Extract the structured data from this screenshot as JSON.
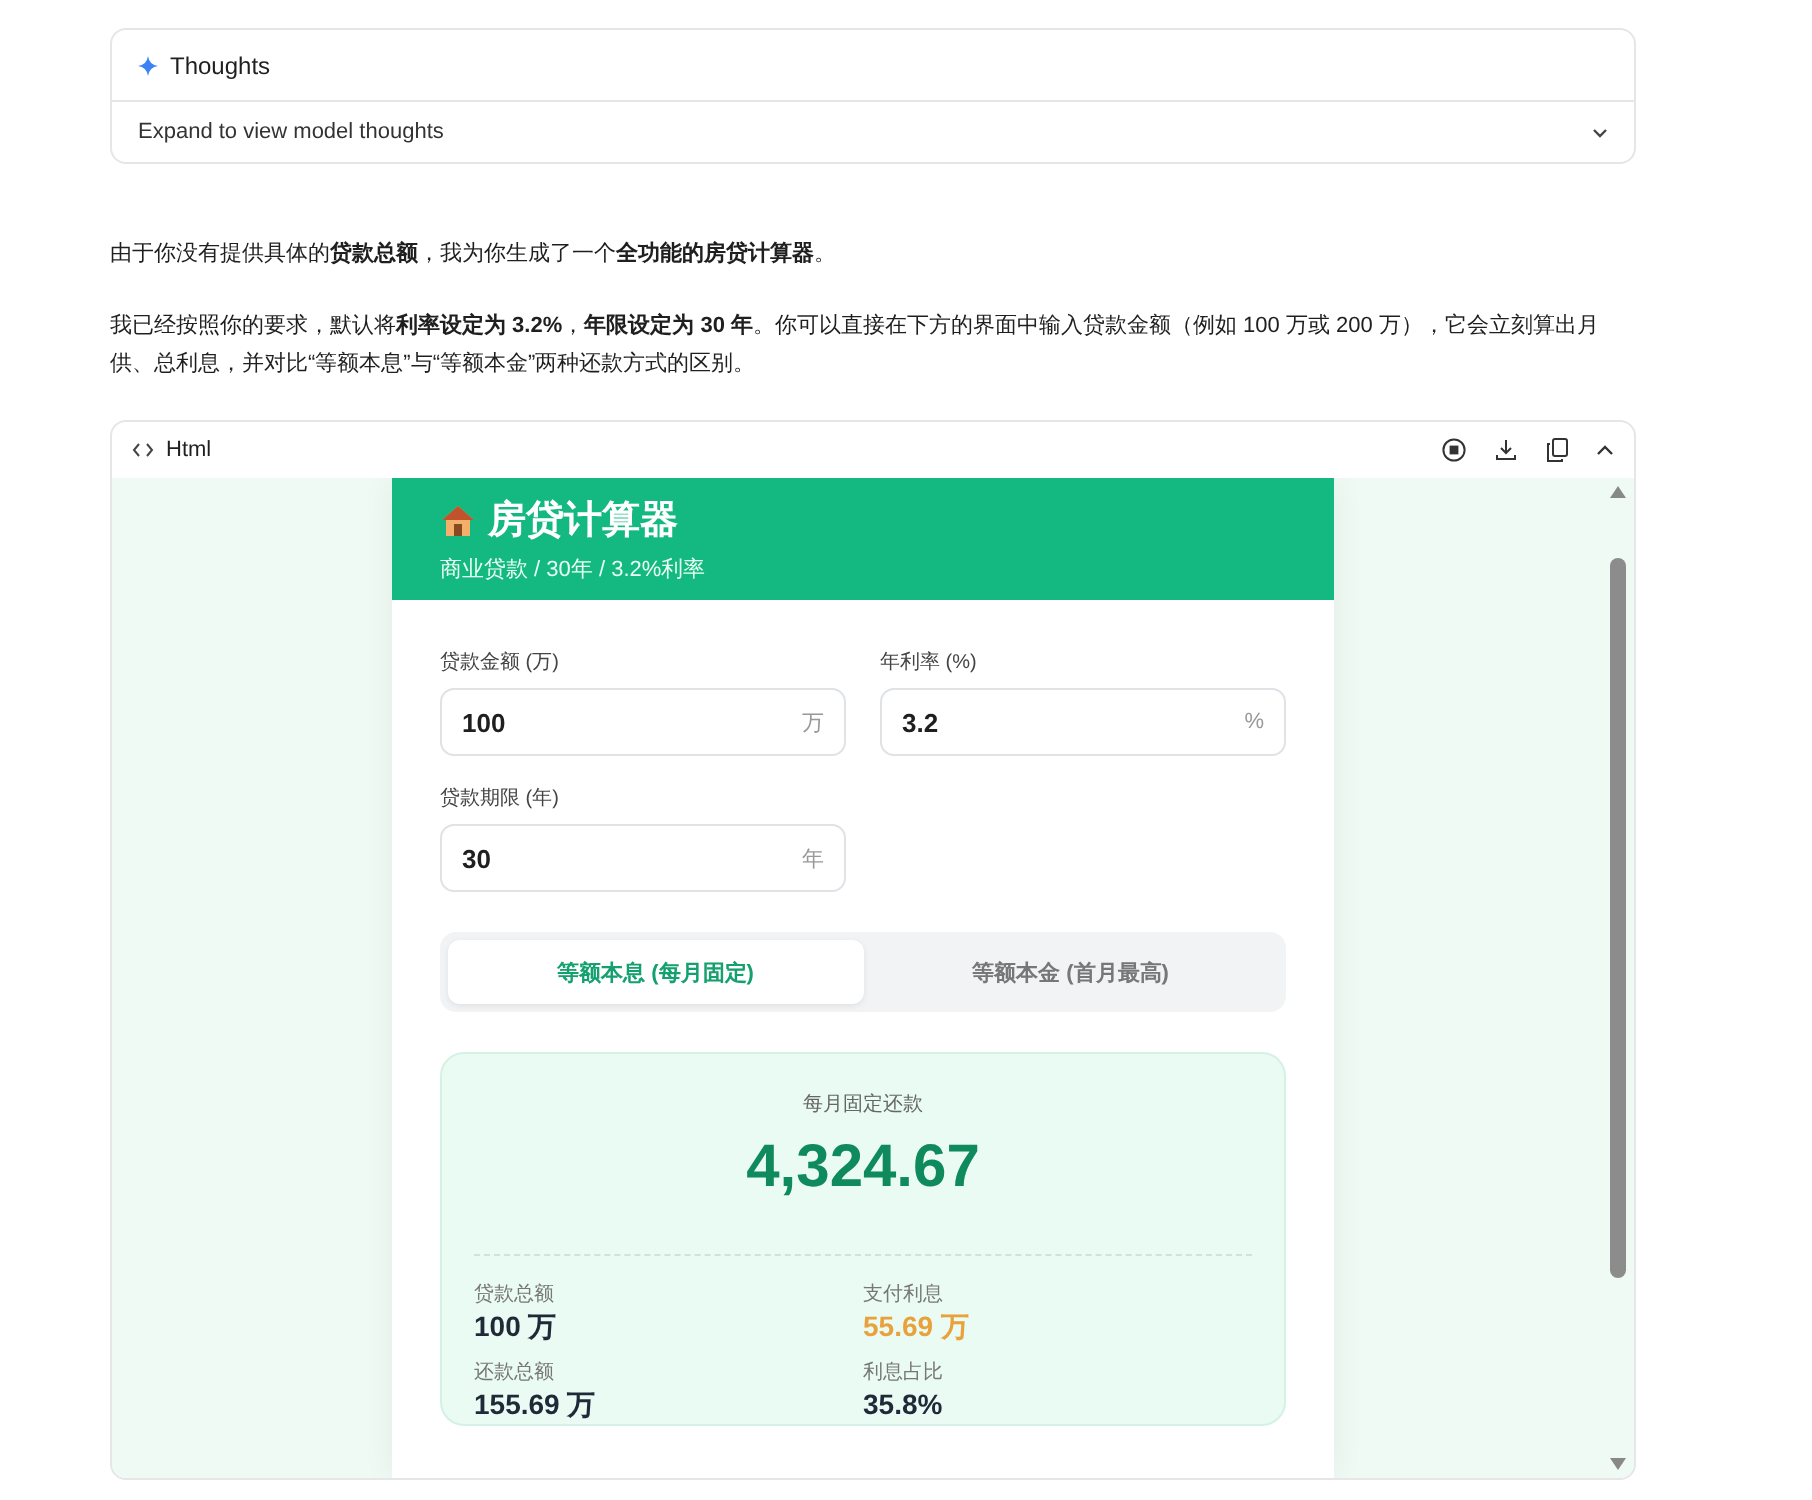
{
  "thoughts": {
    "title": "Thoughts",
    "expand_label": "Expand to view model thoughts",
    "expanded": false
  },
  "paragraphs": [
    "由于你没有提供具体的**贷款总额**，我为你生成了一个**全功能的房贷计算器**。",
    "我已经按照你的要求，默认将**利率设定为 3.2%**，**年限设定为 30 年**。你可以直接在下方的界面中输入贷款金额（例如 100 万或 200 万），它会立刻算出月供、总利息，并对比“等额本息”与“等额本金”两种还款方式的区别。"
  ],
  "html_panel": {
    "title": "Html",
    "calculator": {
      "title": "房贷计算器",
      "subtitle": "商业贷款 / 30年 / 3.2%利率",
      "fields": [
        {
          "label": "贷款金额 (万)",
          "value": "100",
          "unit": "万"
        },
        {
          "label": "年利率 (%)",
          "value": "3.2",
          "unit": "%"
        },
        {
          "label": "贷款期限 (年)",
          "value": "30",
          "unit": "年"
        }
      ],
      "tabs": [
        {
          "label": "等额本息 (每月固定)",
          "selected": true
        },
        {
          "label": "等额本金 (首月最高)",
          "selected": false
        }
      ],
      "result": {
        "label": "每月固定还款",
        "amount": "4,324.67",
        "stats": [
          {
            "label": "贷款总额",
            "value": "100 万",
            "color": "#1f2937"
          },
          {
            "label": "支付利息",
            "value": "55.69 万",
            "color": "#e9a23b"
          },
          {
            "label": "还款总额",
            "value": "155.69 万",
            "color": "#1f2937"
          },
          {
            "label": "利息占比",
            "value": "35.8%",
            "color": "#1f2937"
          }
        ]
      }
    }
  }
}
